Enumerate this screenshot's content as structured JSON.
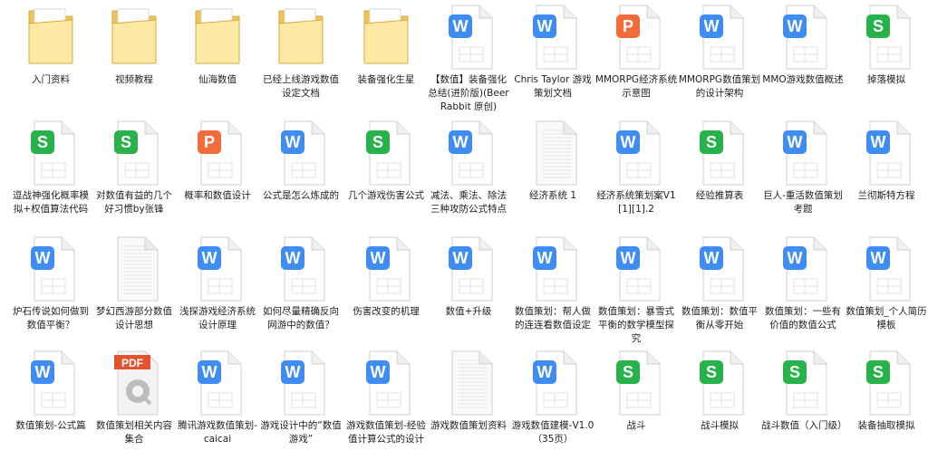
{
  "files": [
    {
      "name": "入门资料",
      "kind": "folder"
    },
    {
      "name": "视频教程",
      "kind": "folder"
    },
    {
      "name": "仙海数值",
      "kind": "folder"
    },
    {
      "name": "已经上线游戏数值设定文档",
      "kind": "folder"
    },
    {
      "name": "装备强化生星",
      "kind": "folder"
    },
    {
      "name": "【数值】装备强化总结(进阶版)(BeerRabbit 原创)",
      "kind": "word"
    },
    {
      "name": "Chris Taylor 游戏策划文档",
      "kind": "word"
    },
    {
      "name": "MMORPG经济系统示意图",
      "kind": "ppt"
    },
    {
      "name": "MMORPG数值策划的设计架构",
      "kind": "word"
    },
    {
      "name": "MMO游戏数值概述",
      "kind": "word"
    },
    {
      "name": "掉落模拟",
      "kind": "sheet"
    },
    {
      "name": "逗战神强化概率模拟+权值算法代码",
      "kind": "sheet"
    },
    {
      "name": "对数值有益的几个好习惯by张锋",
      "kind": "sheet"
    },
    {
      "name": "概率和数值设计",
      "kind": "ppt"
    },
    {
      "name": "公式是怎么炼成的",
      "kind": "word"
    },
    {
      "name": "几个游戏伤害公式",
      "kind": "sheet"
    },
    {
      "name": "减法、乘法、除法三种攻防公式特点",
      "kind": "word"
    },
    {
      "name": "经济系统 1",
      "kind": "text"
    },
    {
      "name": "经济系统策划案V1[1][1].2",
      "kind": "word"
    },
    {
      "name": "经验推算表",
      "kind": "sheet"
    },
    {
      "name": "巨人-重活数值策划考题",
      "kind": "word"
    },
    {
      "name": "兰彻斯特方程",
      "kind": "word"
    },
    {
      "name": "炉石传说如何做到数值平衡？",
      "kind": "word"
    },
    {
      "name": "梦幻西游部分数值设计思想",
      "kind": "text"
    },
    {
      "name": "浅探游戏经济系统设计原理",
      "kind": "word"
    },
    {
      "name": "如何尽量精确反向网游中的数值？",
      "kind": "word"
    },
    {
      "name": "伤害改变的机理",
      "kind": "word"
    },
    {
      "name": "数值+升级",
      "kind": "word"
    },
    {
      "name": "数值策划：帮人做的连连看数值设定",
      "kind": "word"
    },
    {
      "name": "数值策划：暴雪式平衡的数学模型探究",
      "kind": "word"
    },
    {
      "name": "数值策划：数值平衡从零开始",
      "kind": "word"
    },
    {
      "name": "数值策划：一些有价值的数值公式",
      "kind": "word"
    },
    {
      "name": "数值策划_个人简历模板",
      "kind": "word"
    },
    {
      "name": "数值策划-公式篇",
      "kind": "word"
    },
    {
      "name": "数值策划相关内容集合",
      "kind": "pdf"
    },
    {
      "name": "腾讯游戏数值策划-caicai",
      "kind": "word"
    },
    {
      "name": "游戏设计中的“数值游戏”",
      "kind": "word"
    },
    {
      "name": "游戏数值策划-经验值计算公式的设计",
      "kind": "word"
    },
    {
      "name": "游戏数值策划资料",
      "kind": "text"
    },
    {
      "name": "游戏数值建模-V1.0（35页）",
      "kind": "word"
    },
    {
      "name": "战斗",
      "kind": "sheet"
    },
    {
      "name": "战斗模拟",
      "kind": "sheet"
    },
    {
      "name": "战斗数值（入门级）",
      "kind": "sheet"
    },
    {
      "name": "装备抽取模拟",
      "kind": "sheet"
    }
  ],
  "glyphs": {
    "word": "W",
    "ppt": "P",
    "sheet": "S",
    "pdf": "PDF"
  },
  "colors": {
    "word": "#3f8df2",
    "ppt": "#f26b3a",
    "sheet": "#27b24b",
    "pdf": "#e5522e",
    "folder_light": "#fde8a4",
    "folder_dark": "#eec35c",
    "folder_edge": "#d9a93d"
  }
}
